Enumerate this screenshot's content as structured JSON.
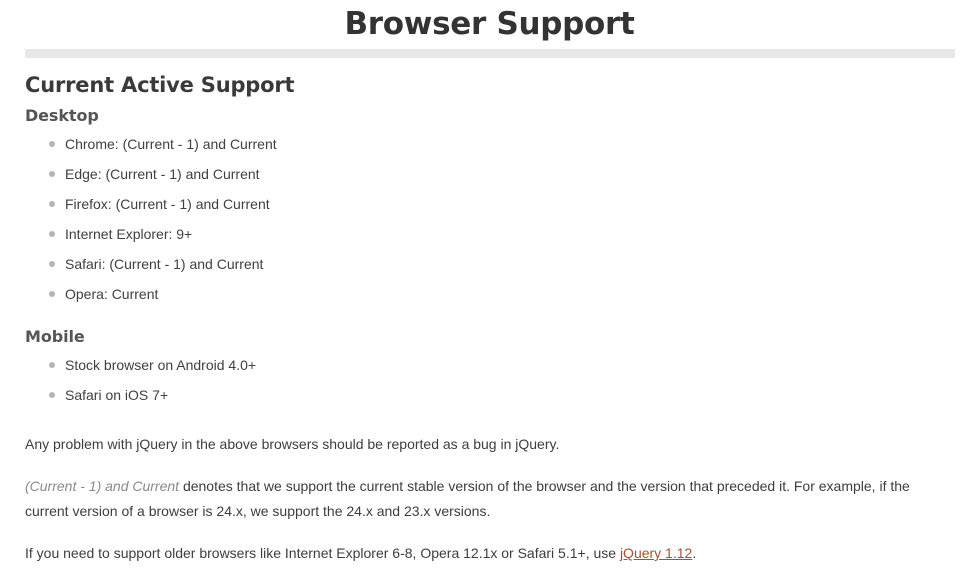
{
  "page": {
    "title": "Browser Support"
  },
  "sections": {
    "current_active_support": {
      "heading": "Current Active Support",
      "desktop": {
        "heading": "Desktop",
        "items": [
          "Chrome: (Current - 1) and Current",
          "Edge: (Current - 1) and Current",
          "Firefox: (Current - 1) and Current",
          "Internet Explorer: 9+",
          "Safari: (Current - 1) and Current",
          "Opera: Current"
        ]
      },
      "mobile": {
        "heading": "Mobile",
        "items": [
          "Stock browser on Android 4.0+",
          "Safari on iOS 7+"
        ]
      }
    }
  },
  "notes": {
    "bug_report": "Any problem with jQuery in the above browsers should be reported as a bug in jQuery.",
    "denotes": {
      "emphasis": "(Current - 1) and Current",
      "rest": " denotes that we support the current stable version of the browser and the version that preceded it. For example, if the current version of a browser is 24.x, we support the 24.x and 23.x versions."
    },
    "older_browsers": {
      "lead": "If you need to support older browsers like Internet Explorer 6-8, Opera 12.1x or Safari 5.1+, use ",
      "link_label": "jQuery 1.12",
      "trail": "."
    }
  },
  "colors": {
    "title": "#333333",
    "heading": "#3a3a3a",
    "subheading": "#555555",
    "body": "#3d3d3d",
    "muted": "#8a8a8a",
    "bullet": "#b5b5b5",
    "divider": "#e7e7e7",
    "link": "#a5522b",
    "background": "#ffffff"
  }
}
